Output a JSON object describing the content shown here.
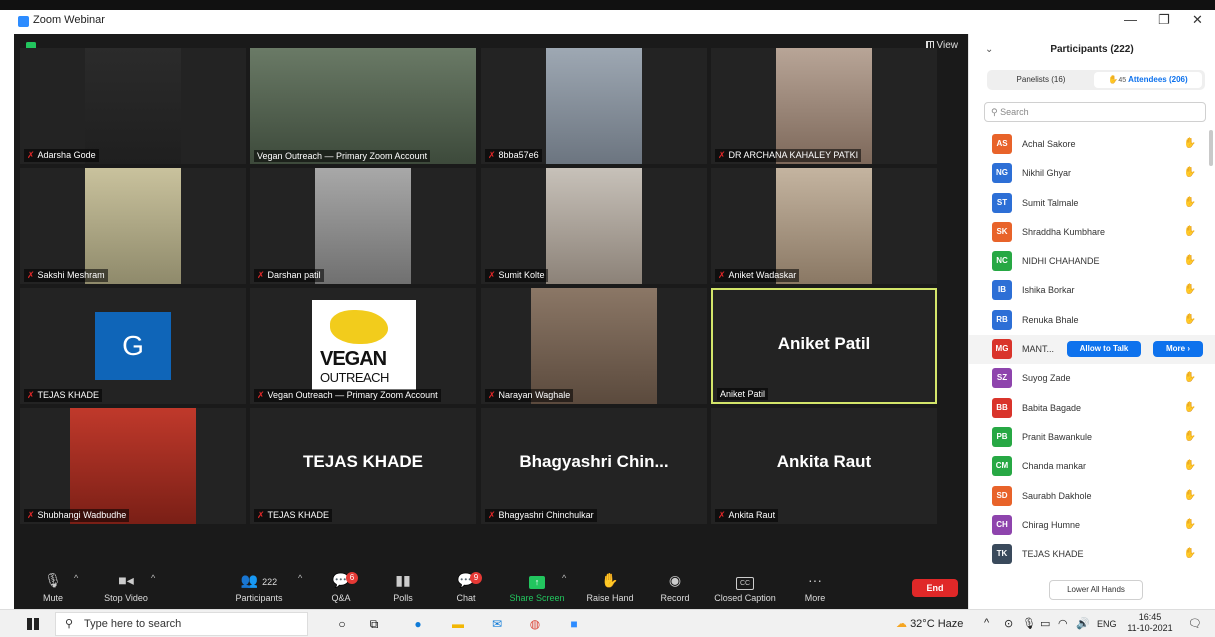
{
  "window": {
    "title": "Zoom Webinar",
    "controls": {
      "minimize": "—",
      "restore": "❐",
      "close": "✕"
    },
    "view_label": "View"
  },
  "tiles": [
    {
      "type": "video",
      "name": "Adarsha Gode",
      "muted": true
    },
    {
      "type": "video",
      "name": "Vegan Outreach — Primary Zoom Account",
      "muted": false
    },
    {
      "type": "video",
      "name": "8bba57e6",
      "muted": true
    },
    {
      "type": "video",
      "name": "DR ARCHANA KAHALEY PATKI",
      "muted": true
    },
    {
      "type": "video",
      "name": "Sakshi Meshram",
      "muted": true
    },
    {
      "type": "video",
      "name": "Darshan patil",
      "muted": true
    },
    {
      "type": "video",
      "name": "Sumit Kolte",
      "muted": true
    },
    {
      "type": "video",
      "name": "Aniket Wadaskar",
      "muted": true
    },
    {
      "type": "avatar",
      "name": "TEJAS KHADE",
      "letter": "G",
      "muted": true
    },
    {
      "type": "logo",
      "name": "Vegan Outreach — Primary Zoom Account",
      "logo_line1": "VEGAN",
      "logo_line2": "OUTREACH",
      "muted": true
    },
    {
      "type": "video",
      "name": "Narayan Waghale",
      "muted": true
    },
    {
      "type": "text",
      "name": "Aniket Patil",
      "display": "Aniket Patil",
      "muted": false,
      "active": true
    },
    {
      "type": "video",
      "name": "Shubhangi Wadbudhe",
      "muted": true
    },
    {
      "type": "text",
      "name": "TEJAS KHADE",
      "display": "TEJAS KHADE",
      "muted": true
    },
    {
      "type": "text",
      "name": "Bhagyashri Chinchulkar",
      "display": "Bhagyashri  Chin...",
      "muted": true
    },
    {
      "type": "text",
      "name": "Ankita Raut",
      "display": "Ankita Raut",
      "muted": true
    }
  ],
  "toolbar": {
    "mute": "Mute",
    "stop_video": "Stop Video",
    "participants": "Participants",
    "participants_count": "222",
    "qa": "Q&A",
    "qa_badge": "6",
    "polls": "Polls",
    "chat": "Chat",
    "chat_badge": "9",
    "share_screen": "Share Screen",
    "raise_hand": "Raise Hand",
    "record": "Record",
    "closed_caption": "Closed Caption",
    "cc_label": "CC",
    "more": "More",
    "end": "End"
  },
  "panel": {
    "title": "Participants (222)",
    "panelists_tab": "Panelists (16)",
    "hand_count": "45",
    "attendees_tab": "Attendees (206)",
    "search_placeholder": "Search",
    "allow_to_talk": "Allow to Talk",
    "more": "More ›",
    "lower_all_hands": "Lower All Hands",
    "attendees": [
      {
        "initials": "AS",
        "name": "Achal Sakore",
        "color": "#e8632a"
      },
      {
        "initials": "NG",
        "name": "Nikhil Ghyar",
        "color": "#2d6fd6"
      },
      {
        "initials": "ST",
        "name": "Sumit Talmale",
        "color": "#2d6fd6"
      },
      {
        "initials": "SK",
        "name": "Shraddha Kumbhare",
        "color": "#e8632a"
      },
      {
        "initials": "NC",
        "name": "NIDHI CHAHANDE",
        "color": "#27a844"
      },
      {
        "initials": "IB",
        "name": "Ishika Borkar",
        "color": "#2d6fd6"
      },
      {
        "initials": "RB",
        "name": "Renuka Bhale",
        "color": "#2d6fd6"
      },
      {
        "initials": "MG",
        "name": "MANT...",
        "color": "#d9342b",
        "highlight": true
      },
      {
        "initials": "SZ",
        "name": "Suyog Zade",
        "color": "#8e44ad"
      },
      {
        "initials": "BB",
        "name": "Babita Bagade",
        "color": "#d9342b"
      },
      {
        "initials": "PB",
        "name": "Pranit Bawankule",
        "color": "#27a844"
      },
      {
        "initials": "CM",
        "name": "Chanda mankar",
        "color": "#27a844"
      },
      {
        "initials": "SD",
        "name": "Saurabh Dakhole",
        "color": "#e8632a"
      },
      {
        "initials": "CH",
        "name": "Chirag Humne",
        "color": "#8e44ad"
      },
      {
        "initials": "TK",
        "name": "TEJAS KHADE",
        "color": "#3a4a5c"
      }
    ]
  },
  "taskbar": {
    "search_placeholder": "Type here to search",
    "weather": "32°C  Haze",
    "language": "ENG",
    "time": "16:45",
    "date": "11-10-2021"
  }
}
